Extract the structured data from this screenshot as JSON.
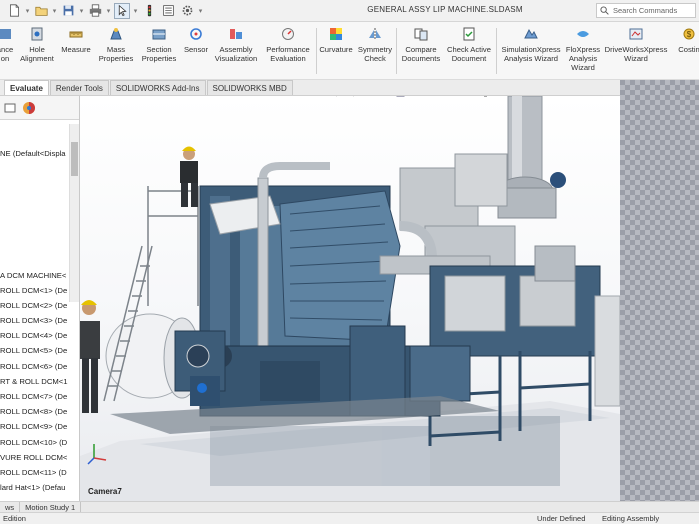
{
  "titlebar": {
    "document_title": "GENERAL ASSY LIP MACHINE.SLDASM",
    "search_placeholder": "Search Commands"
  },
  "ribbon": {
    "tools": [
      {
        "id": "interference",
        "label_lines": [
          "ance",
          "on"
        ]
      },
      {
        "id": "hole",
        "label_lines": [
          "Hole",
          "Alignment"
        ]
      },
      {
        "id": "measure",
        "label_lines": [
          "Measure",
          ""
        ]
      },
      {
        "id": "mass",
        "label_lines": [
          "Mass",
          "Properties"
        ]
      },
      {
        "id": "section",
        "label_lines": [
          "Section",
          "Properties"
        ]
      },
      {
        "id": "sensor",
        "label_lines": [
          "Sensor",
          ""
        ]
      },
      {
        "id": "assyvis",
        "label_lines": [
          "Assembly",
          "Visualization"
        ]
      },
      {
        "id": "perf",
        "label_lines": [
          "Performance",
          "Evaluation"
        ]
      },
      {
        "id": "curvature",
        "label_lines": [
          "Curvature",
          ""
        ]
      },
      {
        "id": "symmetry",
        "label_lines": [
          "Symmetry",
          "Check"
        ]
      },
      {
        "id": "compare",
        "label_lines": [
          "Compare",
          "Documents"
        ]
      },
      {
        "id": "checkactive",
        "label_lines": [
          "Check Active",
          "Document"
        ]
      },
      {
        "id": "simx",
        "label_lines": [
          "SimulationXpress",
          "Analysis Wizard"
        ]
      },
      {
        "id": "flox",
        "label_lines": [
          "FloXpress",
          "Analysis",
          "Wizard"
        ]
      },
      {
        "id": "drivex",
        "label_lines": [
          "DriveWorksXpress",
          "Wizard"
        ]
      },
      {
        "id": "costing",
        "label_lines": [
          "Costin",
          ""
        ]
      }
    ]
  },
  "tabs": [
    {
      "label": "Evaluate",
      "active": true
    },
    {
      "label": "Render Tools",
      "active": false
    },
    {
      "label": "SOLIDWORKS Add-Ins",
      "active": false
    },
    {
      "label": "SOLIDWORKS MBD",
      "active": false
    }
  ],
  "tree": {
    "items": [
      "NE  (Default<Displa",
      "",
      "",
      "",
      "",
      "",
      "",
      "",
      "A DCM MACHINE<",
      "ROLL DCM<1> (De",
      "ROLL DCM<2> (De",
      "ROLL DCM<3> (De",
      "ROLL DCM<4> (De",
      "ROLL DCM<5> (De",
      "ROLL DCM<6> (De",
      "RT & ROLL DCM<1",
      "ROLL DCM<7> (De",
      "ROLL DCM<8> (De",
      "ROLL DCM<9> (De",
      "ROLL DCM<10> (D",
      "VURE ROLL DCM<",
      "ROLL DCM<11> (D",
      "lard Hat<1> (Defau"
    ]
  },
  "viewport": {
    "camera_label": "Camera7"
  },
  "bottom_tabs": [
    "ws",
    "Motion Study 1"
  ],
  "status": {
    "left": "Edition",
    "definition": "Under Defined",
    "mode": "Editing Assembly"
  }
}
